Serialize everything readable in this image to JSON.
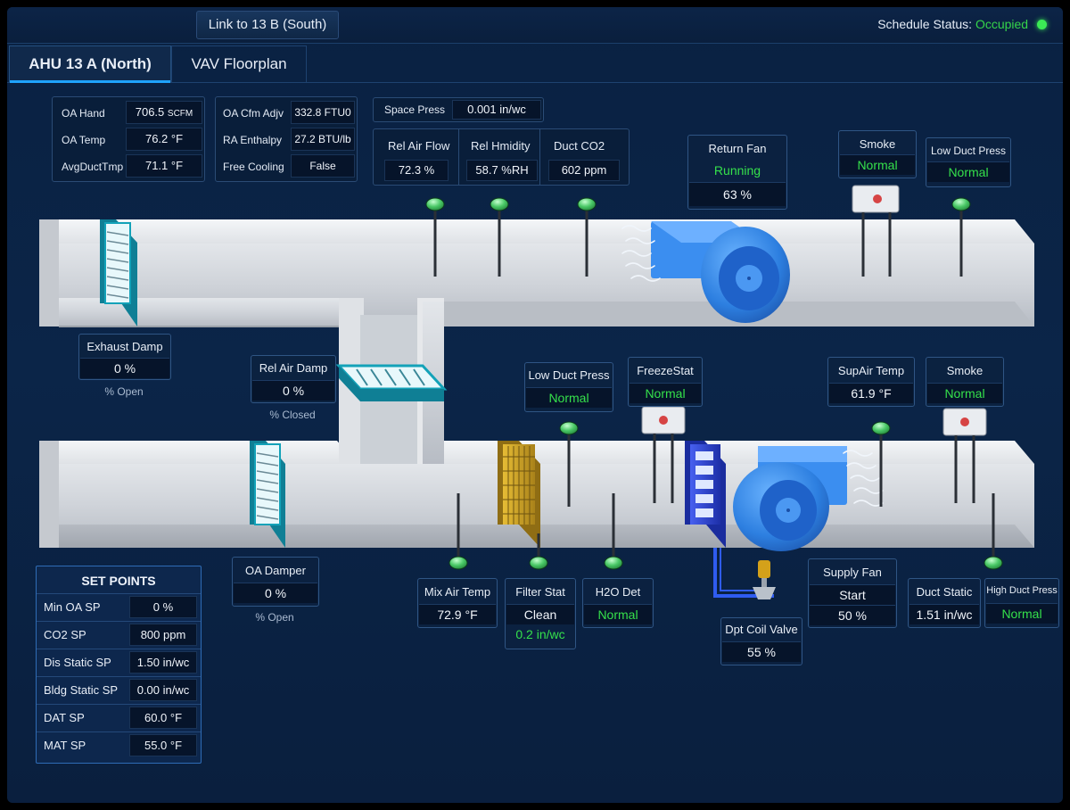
{
  "header": {
    "link_button": "Link to 13 B (South)",
    "schedule_label": "Schedule Status:",
    "schedule_value": "Occupied"
  },
  "tabs": [
    {
      "label": "AHU 13 A (North)",
      "active": true
    },
    {
      "label": "VAV Floorplan",
      "active": false
    }
  ],
  "oa_panel": {
    "rows": [
      {
        "label": "OA Hand",
        "value": "706.5",
        "unit": "SCFM"
      },
      {
        "label": "OA Temp",
        "value": "76.2 °F"
      },
      {
        "label": "AvgDuctTmp",
        "value": "71.1 °F"
      }
    ]
  },
  "cfm_panel": {
    "rows": [
      {
        "label": "OA Cfm Adjv",
        "value": "332.8 FTU0"
      },
      {
        "label": "RA Enthalpy",
        "value": "27.2 BTU/lb"
      },
      {
        "label": "Free Cooling",
        "value": "False"
      }
    ]
  },
  "space_press": {
    "label": "Space Press",
    "value": "0.001 in/wc"
  },
  "air_quality": [
    {
      "label": "Rel Air Flow",
      "value": "72.3 %"
    },
    {
      "label": "Rel Hmidity",
      "value": "58.7 %RH"
    },
    {
      "label": "Duct CO2",
      "value": "602 ppm"
    }
  ],
  "return_fan": {
    "label": "Return Fan",
    "status": "Running",
    "speed": "63 %"
  },
  "smoke_return": {
    "label": "Smoke",
    "status": "Normal"
  },
  "low_duct_press_return": {
    "label": "Low Duct Press",
    "status": "Normal"
  },
  "exhaust_damp": {
    "label": "Exhaust Damp",
    "value": "0 %",
    "caption": "% Open"
  },
  "rel_air_damp": {
    "label": "Rel Air Damp",
    "value": "0 %",
    "caption": "% Closed"
  },
  "oa_damper": {
    "label": "OA Damper",
    "value": "0 %",
    "caption": "% Open"
  },
  "low_duct_press_supply": {
    "label": "Low Duct Press",
    "status": "Normal"
  },
  "freezestat": {
    "label": "FreezeStat",
    "status": "Normal"
  },
  "sup_air_temp": {
    "label": "SupAir Temp",
    "value": "61.9  °F"
  },
  "smoke_supply": {
    "label": "Smoke",
    "status": "Normal"
  },
  "mix_air_temp": {
    "label": "Mix Air Temp",
    "value": "72.9  °F"
  },
  "filter_stat": {
    "label": "Filter Stat",
    "status": "Clean",
    "dp": "0.2 in/wc"
  },
  "h2o_det": {
    "label": "H2O Det",
    "status": "Normal"
  },
  "dpt_coil_valve": {
    "label": "Dpt Coil Valve",
    "value": "55 %"
  },
  "supply_fan": {
    "label": "Supply Fan",
    "command": "Start",
    "speed": "50 %"
  },
  "duct_static": {
    "label": "Duct Static",
    "value": "1.51 in/wc"
  },
  "high_duct_press": {
    "label": "High Duct Press",
    "status": "Normal"
  },
  "set_points": {
    "title": "SET POINTS",
    "rows": [
      {
        "label": "Min OA SP",
        "value": "0 %"
      },
      {
        "label": "CO2 SP",
        "value": "800 ppm"
      },
      {
        "label": "Dis Static SP",
        "value": "1.50  in/wc"
      },
      {
        "label": "Bldg Static SP",
        "value": "0.00  in/wc"
      },
      {
        "label": "DAT SP",
        "value": "60.0 °F"
      },
      {
        "label": "MAT SP",
        "value": "55.0 °F"
      }
    ]
  },
  "colors": {
    "background": "#0a2142",
    "accent": "#1fa3ff",
    "status_green": "#35e14b",
    "duct": "#d6d9de",
    "fan": "#2f86e8",
    "filter": "#c9a227",
    "coil": "#2c45d8",
    "damper": "#20b3c8"
  },
  "icons": [
    "status-led-icon",
    "sensor-probe-icon",
    "smoke-detector-icon",
    "fan-icon",
    "damper-icon",
    "filter-icon",
    "coil-icon",
    "valve-icon",
    "airflow-icon"
  ]
}
